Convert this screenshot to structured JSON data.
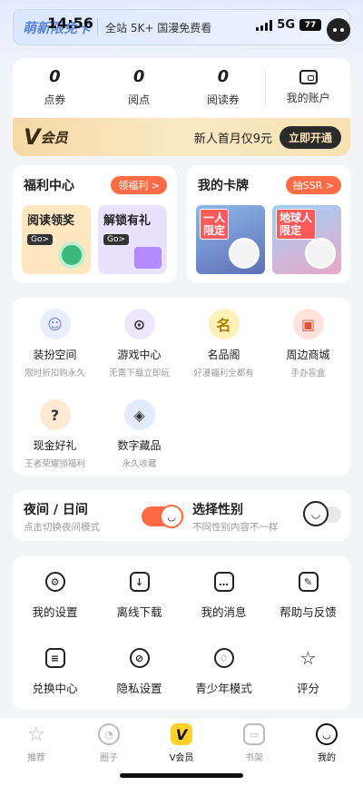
{
  "status_bar": {
    "time": "14:56",
    "network": "5G",
    "battery": "77"
  },
  "banner": {
    "brand": "萌新限免卡",
    "promo": "全站 5K+ 国漫免费看"
  },
  "account": {
    "stats": [
      {
        "value": "0",
        "label": "点券"
      },
      {
        "value": "0",
        "label": "阅点"
      },
      {
        "value": "0",
        "label": "阅读券"
      }
    ],
    "my_account_label": "我的账户",
    "vip": {
      "logo": "V",
      "title": "会员",
      "desc": "新人首月仅9元",
      "button": "立即开通"
    }
  },
  "welfare": {
    "title": "福利中心",
    "pill": "领福利 >",
    "tiles": [
      {
        "title": "阅读领奖",
        "go": "Go>"
      },
      {
        "title": "解锁有礼",
        "go": "Go>"
      }
    ]
  },
  "my_cards": {
    "title": "我的卡牌",
    "pill": "抽SSR >",
    "cards": [
      {
        "label": "一人\n限定"
      },
      {
        "label": "地球人\n限定"
      }
    ]
  },
  "services": [
    {
      "name": "装扮空间",
      "sub": "限时折扣购永久",
      "icon": "dressup-avatar-icon",
      "color": "#e9eefc"
    },
    {
      "name": "游戏中心",
      "sub": "无需下载立即玩",
      "icon": "gamepad-icon",
      "color": "#ece6ff"
    },
    {
      "name": "名品阁",
      "sub": "好漫福利全都有",
      "icon": "famous-badge-icon",
      "color": "#fff2b8"
    },
    {
      "name": "周边商城",
      "sub": "手办盲盒",
      "icon": "shop-box-icon",
      "color": "#ffe3dc"
    },
    {
      "name": "现金好礼",
      "sub": "王者荣耀领福利",
      "icon": "cash-gift-icon",
      "color": "#ffe9d2"
    },
    {
      "name": "数字藏品",
      "sub": "永久收藏",
      "icon": "digital-collectible-icon",
      "color": "#e3ecff"
    }
  ],
  "toggles": {
    "night": {
      "title": "夜间 / 日间",
      "sub": "点击切换夜间模式",
      "on": true
    },
    "gender": {
      "title": "选择性别",
      "sub": "不同性别内容不一样"
    }
  },
  "settings": [
    {
      "name": "我的设置",
      "icon": "settings-icon"
    },
    {
      "name": "离线下载",
      "icon": "download-icon"
    },
    {
      "name": "我的消息",
      "icon": "message-icon"
    },
    {
      "name": "帮助与反馈",
      "icon": "feedback-icon"
    },
    {
      "name": "兑换中心",
      "icon": "redeem-ticket-icon"
    },
    {
      "name": "隐私设置",
      "icon": "privacy-icon"
    },
    {
      "name": "青少年模式",
      "icon": "teen-mode-icon"
    },
    {
      "name": "评分",
      "icon": "rating-star-icon"
    }
  ],
  "tabbar": [
    {
      "label": "推荐",
      "icon": "star-icon"
    },
    {
      "label": "圈子",
      "icon": "circle-icon"
    },
    {
      "label": "V会员",
      "icon": "vip-v-icon"
    },
    {
      "label": "书架",
      "icon": "bookshelf-icon"
    },
    {
      "label": "我的",
      "icon": "profile-face-icon",
      "active": true
    }
  ]
}
